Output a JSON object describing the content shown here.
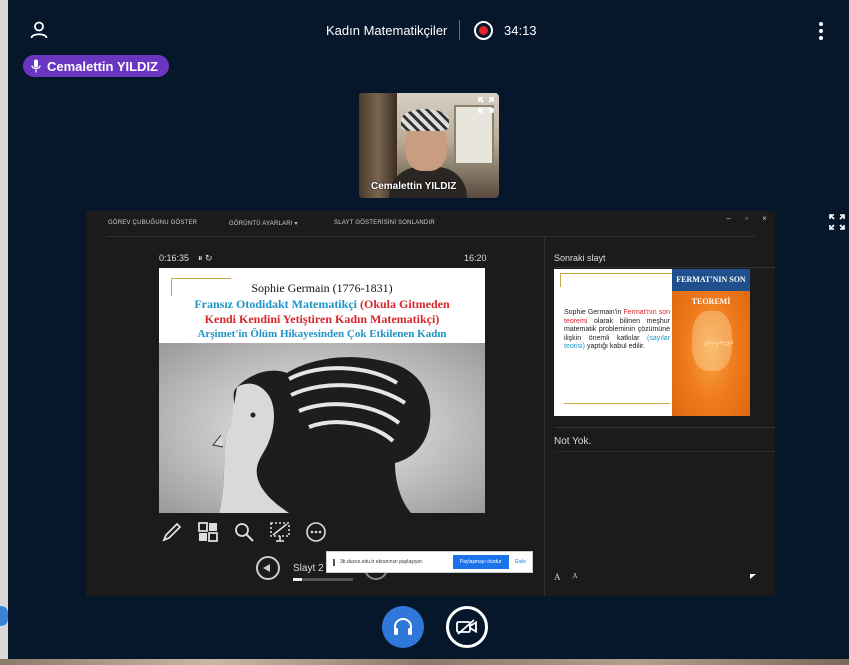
{
  "header": {
    "meeting_title": "Kadın Matematikçiler",
    "recording_time": "34:13"
  },
  "talker": {
    "name": "Cemalettin YILDIZ"
  },
  "webcam": {
    "name": "Cemalettin YILDIZ"
  },
  "presenter": {
    "toolbar": {
      "show_taskbar": "GÖREV ÇUBUĞUNU GÖSTER",
      "display_settings": "GÖRÜNTÜ AYARLARI ▾",
      "end_slideshow": "SLAYT GÖSTERİSİNİ SONLANDIR"
    },
    "window_controls": [
      "–",
      "▫",
      "×"
    ],
    "elapsed": "0:16:35",
    "timer_controls": "⏸ ↻",
    "clock": "16:20",
    "slide": {
      "title": "Sophie Germain (1776-1831)",
      "line1_part1": "Fransız Otodidakt Matematikçi",
      "line1_part2": " (Okula Gitmeden",
      "line2": "Kendi Kendini Yetiştiren Kadın Matematikçi)",
      "line3": "Arşimet'in Ölüm Hikayesinden Çok Etkilenen Kadın"
    },
    "slide_counter": "Slayt 2",
    "progress_fraction": 0.15,
    "next_slide_label": "Sonraki slayt",
    "next_slide": {
      "heading": "FERMAT'NIN SON TEOREMİ",
      "text_a": "Sophie Germain'in ",
      "text_b": "Fermat'nın son teoremi",
      "text_c": " olarak bilinen meşhur matematik probleminin çözümüne ilişkin önemli katkılar ",
      "text_d": "(sayılar teorisi)",
      "text_e": " yaptığı kabul edilir.",
      "equation": "x²+y²=z²"
    },
    "notes": "Not Yok.",
    "font_controls": [
      "A",
      "A"
    ]
  },
  "share_banner": {
    "message": "3b.duzce.edu.tr ekranınızı paylaşıyor.",
    "stop_button": "Paylaşmayı durdur",
    "hide_button": "Gizle"
  },
  "colors": {
    "background": "#06162b",
    "talker_badge": "#6a35c0",
    "audio_button": "#2f78d9",
    "record": "#e0232c"
  }
}
